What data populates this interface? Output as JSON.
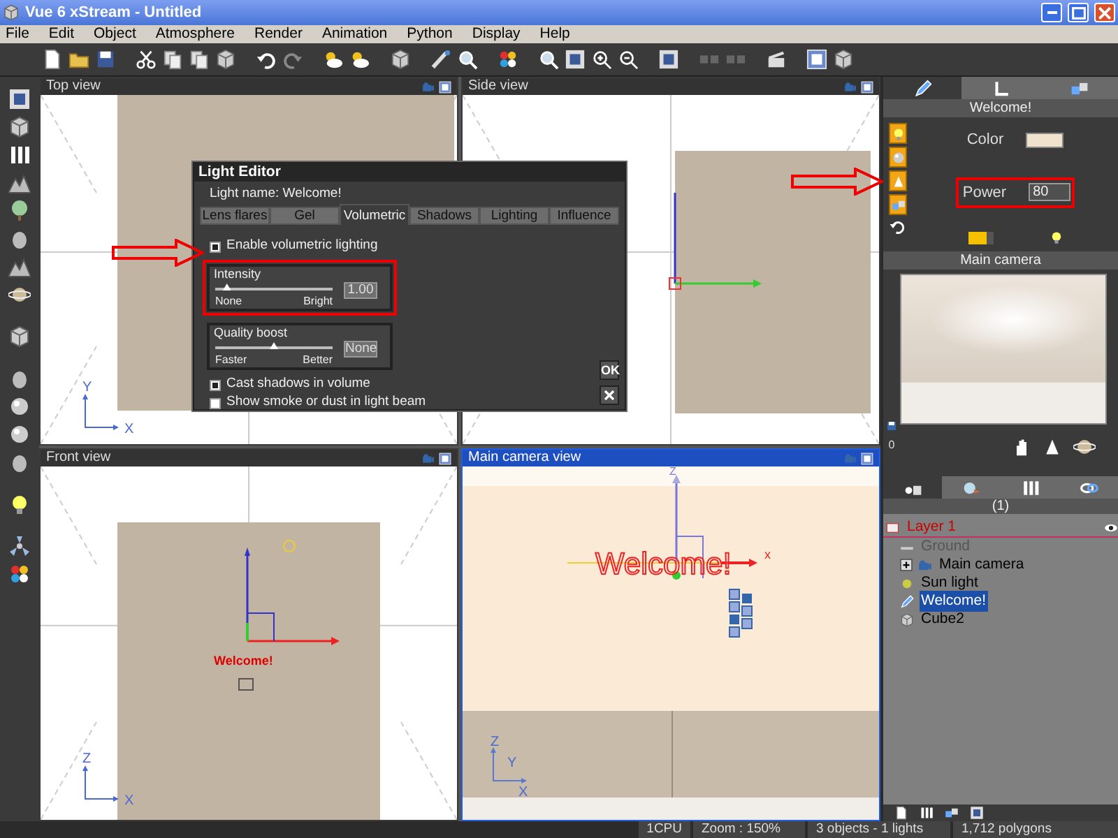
{
  "window": {
    "title": "Vue 6 xStream - Untitled"
  },
  "menu": [
    "File",
    "Edit",
    "Object",
    "Atmosphere",
    "Render",
    "Animation",
    "Python",
    "Display",
    "Help"
  ],
  "viewports": [
    {
      "title": "Top view",
      "kind": "top",
      "selected": false,
      "axis_labels": [
        "Y",
        "X"
      ]
    },
    {
      "title": "Side view",
      "kind": "side",
      "selected": false
    },
    {
      "title": "Front view",
      "kind": "front",
      "selected": false,
      "axis_labels": [
        "Z",
        "X"
      ],
      "object_label": "Welcome!"
    },
    {
      "title": "Main camera view",
      "kind": "camera",
      "selected": true,
      "axis_labels": [
        "Z",
        "Y",
        "X"
      ],
      "object_label": "Welcome!",
      "gizmo_labels": [
        "Z",
        "x"
      ]
    }
  ],
  "light_editor": {
    "title": "Light Editor",
    "light_name": "Light name: Welcome!",
    "tabs": [
      {
        "label": "Lens flares",
        "selected": false
      },
      {
        "label": "Gel",
        "selected": false
      },
      {
        "label": "Volumetric",
        "selected": true
      },
      {
        "label": "Shadows",
        "selected": false
      },
      {
        "label": "Lighting",
        "selected": false
      },
      {
        "label": "Influence",
        "selected": false
      }
    ],
    "enable_volumetric": {
      "label": "Enable volumetric lighting",
      "checked": true
    },
    "intensity": {
      "title": "Intensity",
      "level": 0.1,
      "min_label": "None",
      "max_label": "Bright",
      "value": "1.00"
    },
    "quality_boost": {
      "title": "Quality boost",
      "level": 0.5,
      "min_label": "Faster",
      "max_label": "Better",
      "value": "None"
    },
    "options": [
      {
        "label": "Cast shadows in volume",
        "checked": true
      },
      {
        "label": "Show smoke or dust in light beam",
        "checked": false
      }
    ],
    "ok_button": "OK"
  },
  "properties_panel": {
    "tabs": [
      {
        "kind": "light",
        "selected": true
      },
      {
        "kind": "axes",
        "selected": false
      },
      {
        "kind": "cubes",
        "selected": false
      }
    ],
    "object_name": "Welcome!",
    "color_label": "Color",
    "power_label": "Power",
    "power_value": "80",
    "color_toggle": {
      "on": true
    }
  },
  "camera_preview": {
    "title": "Main camera",
    "frame_number": "0"
  },
  "scene_tabs": [
    {
      "kind": "objects",
      "selected": true
    },
    {
      "kind": "materials",
      "selected": false
    },
    {
      "kind": "bars",
      "selected": false
    },
    {
      "kind": "links",
      "selected": false
    }
  ],
  "tree_header": "(1)",
  "tree": [
    {
      "label": "Layer 1",
      "kind": "layer",
      "selected": false,
      "children": [
        {
          "label": "Ground",
          "kind": "ground",
          "selected": false
        },
        {
          "label": "Main camera",
          "kind": "camera",
          "selected": false,
          "expanded": false
        },
        {
          "label": "Sun light",
          "kind": "sun",
          "selected": false
        },
        {
          "label": "Welcome!",
          "kind": "text",
          "selected": true
        },
        {
          "label": "Cube2",
          "kind": "cube",
          "selected": false
        }
      ]
    }
  ],
  "status_bar": [
    "1CPU",
    "Zoom : 150%",
    "3 objects - 1 lights",
    "1,712 polygons"
  ]
}
